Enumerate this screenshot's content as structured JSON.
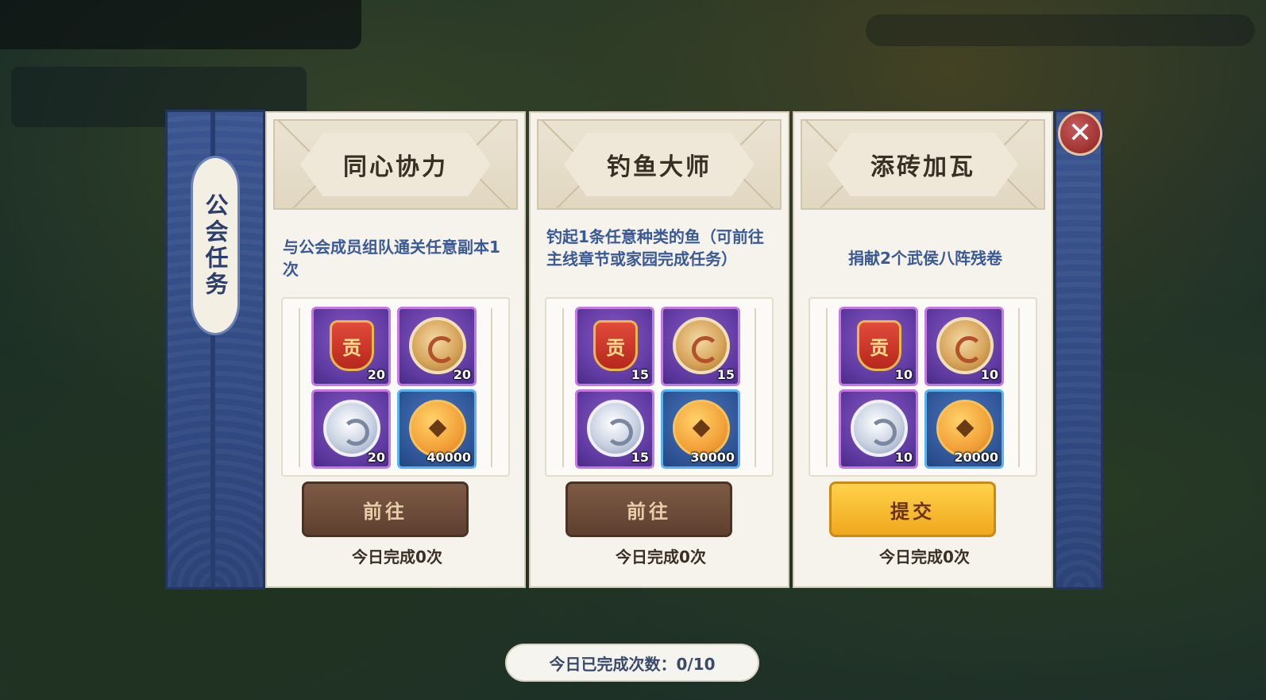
{
  "side_title": "公会任务",
  "close_label": "✕",
  "bottom_status": "今日已完成次数：0/10",
  "colors": {
    "panel_blue": "#2c4378",
    "title_blue": "#3a5a96",
    "epic_border": "#c27ae0",
    "rare_border": "#5ab2ee",
    "button_brown": "#5e4030",
    "button_gold": "#f0a81e"
  },
  "tasks": [
    {
      "title": "同心协力",
      "description": "与公会成员组队通关任意副本1次",
      "rewards": [
        {
          "icon": "contribution-token-icon",
          "rarity": "epic",
          "count": "20"
        },
        {
          "icon": "gold-dragon-medal-icon",
          "rarity": "epic",
          "count": "20"
        },
        {
          "icon": "silver-dragon-medal-icon",
          "rarity": "epic",
          "count": "20"
        },
        {
          "icon": "copper-coin-icon",
          "rarity": "rare",
          "count": "40000"
        }
      ],
      "button_label": "前往",
      "button_style": "brown",
      "footer": "今日完成0次"
    },
    {
      "title": "钓鱼大师",
      "description": "钓起1条任意种类的鱼（可前往主线章节或家园完成任务）",
      "rewards": [
        {
          "icon": "contribution-token-icon",
          "rarity": "epic",
          "count": "15"
        },
        {
          "icon": "gold-dragon-medal-icon",
          "rarity": "epic",
          "count": "15"
        },
        {
          "icon": "silver-dragon-medal-icon",
          "rarity": "epic",
          "count": "15"
        },
        {
          "icon": "copper-coin-icon",
          "rarity": "rare",
          "count": "30000"
        }
      ],
      "button_label": "前往",
      "button_style": "brown",
      "footer": "今日完成0次"
    },
    {
      "title": "添砖加瓦",
      "description": "捐献2个武侯八阵残卷",
      "rewards": [
        {
          "icon": "contribution-token-icon",
          "rarity": "epic",
          "count": "10"
        },
        {
          "icon": "gold-dragon-medal-icon",
          "rarity": "epic",
          "count": "10"
        },
        {
          "icon": "silver-dragon-medal-icon",
          "rarity": "epic",
          "count": "10"
        },
        {
          "icon": "copper-coin-icon",
          "rarity": "rare",
          "count": "20000"
        }
      ],
      "button_label": "提交",
      "button_style": "gold",
      "footer": "今日完成0次"
    }
  ]
}
